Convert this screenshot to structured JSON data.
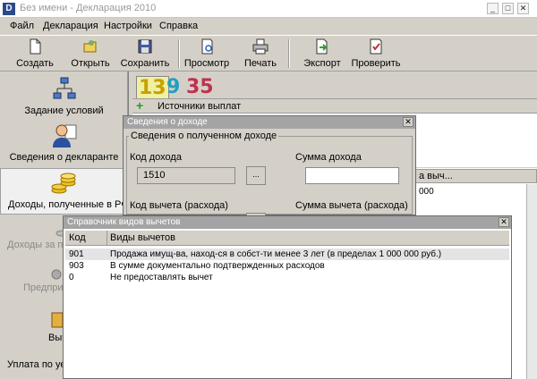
{
  "window": {
    "title": "Без имени - Декларация 2010",
    "minimize": "_",
    "maximize": "□",
    "close": "✕"
  },
  "menu": [
    "Файл",
    "Декларация",
    "Настройки",
    "Справка"
  ],
  "toolbar": {
    "create": "Создать",
    "open": "Открыть",
    "save": "Сохранить",
    "preview": "Просмотр",
    "print": "Печать",
    "export": "Экспорт",
    "check": "Проверить"
  },
  "sidebar": {
    "items": [
      {
        "label": "Задание условий",
        "icon": "flowchart-icon"
      },
      {
        "label": "Сведения о декларанте",
        "icon": "person-icon"
      },
      {
        "label": "Доходы, полученные в РФ",
        "icon": "coins-icon"
      },
      {
        "label": "Доходы за п",
        "icon": "coins-icon"
      },
      {
        "label": "Предпри",
        "icon": "gear-icon"
      },
      {
        "label": "Выч",
        "icon": "deduction-icon"
      },
      {
        "label": "Уплата по уе",
        "icon": ""
      }
    ]
  },
  "rates": {
    "r13": "13",
    "r9": "9",
    "r35": "35"
  },
  "sources": {
    "add": "+",
    "header": "Источники выплат"
  },
  "grid_partial": {
    "header": "а выч...",
    "value": "000"
  },
  "income_dialog": {
    "title": "Сведения о доходе",
    "group_label": "Сведения о полученном доходе",
    "income_code_label": "Код дохода",
    "income_code_value": "1510",
    "browse_button": "...",
    "income_amount_label": "Сумма дохода",
    "income_amount_value": "",
    "deduction_code_label": "Код вычета (расхода)",
    "deduction_amount_label": "Сумма вычета (расхода)",
    "close": "✕"
  },
  "deduction_dialog": {
    "title": "Справочник видов вычетов",
    "close": "✕",
    "columns": {
      "code": "Код",
      "kind": "Виды вычетов"
    },
    "rows": [
      {
        "code": "901",
        "kind": "Продажа имущ-ва, наход-ся в собст-ти менее 3 лет (в пределах 1 000 000 руб.)"
      },
      {
        "code": "903",
        "kind": "В сумме документально подтвержденных расходов"
      },
      {
        "code": "0",
        "kind": "Не предоставлять вычет"
      }
    ]
  }
}
